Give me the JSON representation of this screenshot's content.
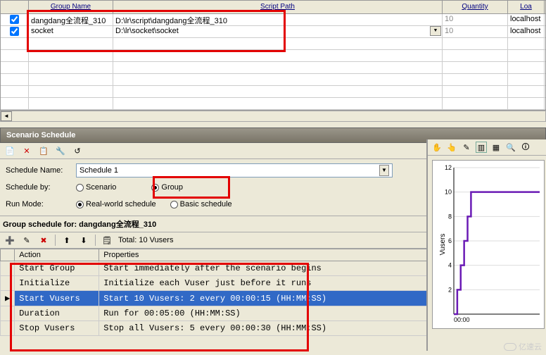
{
  "grid": {
    "headers": {
      "group": "Group Name",
      "path": "Script Path",
      "qty": "Quantity",
      "load": "Loa"
    },
    "rows": [
      {
        "checked": true,
        "group": "dangdang全流程_310",
        "path": "D:\\lr\\script\\dangdang全流程_310",
        "qty": "10",
        "load": "localhost",
        "dropdown": false
      },
      {
        "checked": true,
        "group": "socket",
        "path": "D:\\lr\\socket\\socket",
        "qty": "10",
        "load": "localhost",
        "dropdown": true
      }
    ]
  },
  "panel": {
    "title": "Scenario Schedule"
  },
  "form": {
    "schedule_name_label": "Schedule Name:",
    "schedule_name_value": "Schedule 1",
    "schedule_by_label": "Schedule by:",
    "scenario_label": "Scenario",
    "group_label": "Group",
    "run_mode_label": "Run Mode:",
    "realworld_label": "Real-world schedule",
    "basic_label": "Basic schedule"
  },
  "gs": {
    "title": "Group schedule for: dangdang全流程_310",
    "total": "Total: 10 Vusers",
    "cols": {
      "action": "Action",
      "props": "Properties"
    },
    "rows": [
      {
        "action": "Start Group",
        "props": "Start immediately after the scenario begins",
        "sel": false
      },
      {
        "action": "Initialize",
        "props": "Initialize each Vuser just before it runs",
        "sel": false
      },
      {
        "action": "Start Vusers",
        "props": "Start 10 Vusers: 2 every 00:00:15 (HH:MM:SS)",
        "sel": true
      },
      {
        "action": "Duration",
        "props": "Run for 00:05:00 (HH:MM:SS)",
        "sel": false
      },
      {
        "action": "Stop Vusers",
        "props": "Stop all Vusers: 5 every 00:00:30 (HH:MM:SS)",
        "sel": false
      }
    ]
  },
  "chart_data": {
    "type": "line",
    "title": "",
    "xlabel": "",
    "ylabel": "Vusers",
    "ylim": [
      0,
      12
    ],
    "yticks": [
      2,
      4,
      6,
      8,
      10,
      12
    ],
    "xticks": [
      "00:00"
    ],
    "series": [
      {
        "name": "Vusers",
        "color": "#6a1bb5",
        "x": [
          0,
          15,
          15,
          30,
          30,
          45,
          45,
          60,
          60,
          75,
          75,
          375
        ],
        "y": [
          0,
          0,
          2,
          2,
          4,
          4,
          6,
          6,
          8,
          8,
          10,
          10
        ]
      }
    ]
  },
  "watermark": "亿速云"
}
